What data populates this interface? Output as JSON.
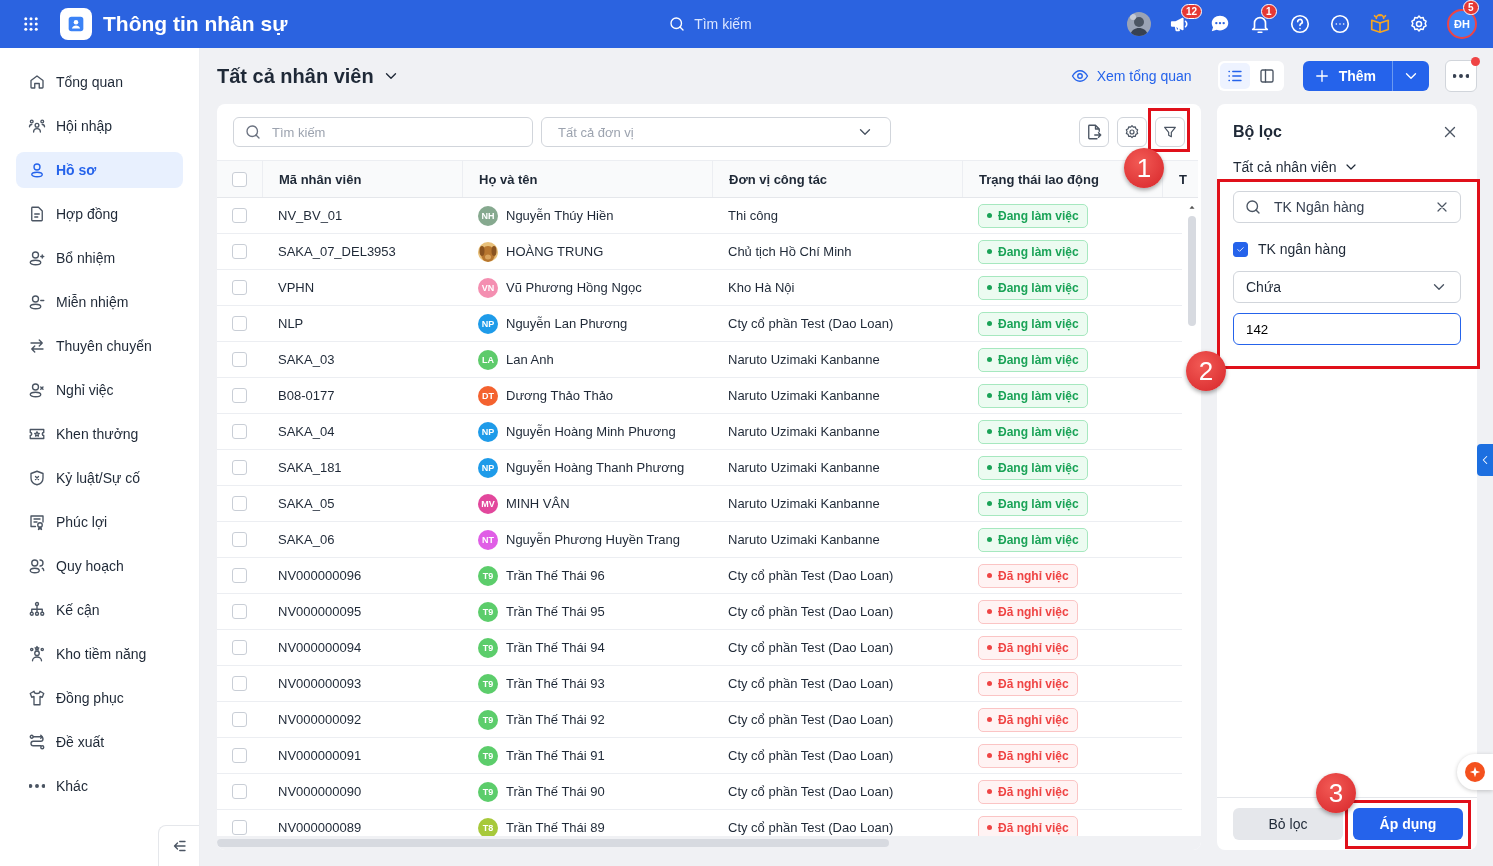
{
  "topbar": {
    "title": "Thông tin nhân sự",
    "search": {
      "placeholder": "Tìm kiếm"
    },
    "announcements_badge": "12",
    "notifications_badge": "1",
    "profile": {
      "initials": "ĐH",
      "badge": "5"
    }
  },
  "sidebar": {
    "items": [
      {
        "label": "Tổng quan",
        "selected": false
      },
      {
        "label": "Hội nhập",
        "selected": false
      },
      {
        "label": "Hồ sơ",
        "selected": true
      },
      {
        "label": "Hợp đồng",
        "selected": false
      },
      {
        "label": "Bổ nhiệm",
        "selected": false
      },
      {
        "label": "Miễn nhiệm",
        "selected": false
      },
      {
        "label": "Thuyên chuyển",
        "selected": false
      },
      {
        "label": "Nghỉ việc",
        "selected": false
      },
      {
        "label": "Khen thưởng",
        "selected": false
      },
      {
        "label": "Kỷ luật/Sự cố",
        "selected": false
      },
      {
        "label": "Phúc lợi",
        "selected": false
      },
      {
        "label": "Quy hoạch",
        "selected": false
      },
      {
        "label": "Kế cận",
        "selected": false
      },
      {
        "label": "Kho tiềm năng",
        "selected": false
      },
      {
        "label": "Đồng phục",
        "selected": false
      },
      {
        "label": "Đề xuất",
        "selected": false
      },
      {
        "label": "Khác",
        "selected": false
      }
    ]
  },
  "page": {
    "title": "Tất cả nhân viên",
    "overview_link": "Xem tổng quan",
    "views": [
      {
        "kind": "list",
        "selected": true
      },
      {
        "kind": "panel",
        "selected": false
      }
    ],
    "add_button": "Thêm"
  },
  "table": {
    "search": {
      "placeholder": "Tìm kiếm"
    },
    "unit_select": {
      "placeholder": "Tất cả đơn vị"
    },
    "all_checked": false,
    "columns": [
      "Mã nhân viên",
      "Họ và tên",
      "Đơn vị công tác",
      "Trạng thái lao động",
      "T"
    ],
    "rows": [
      {
        "checked": false,
        "code": "NV_BV_01",
        "avatar": {
          "kind": "initials",
          "text": "NH",
          "color": "#86a98f"
        },
        "name": "Nguyễn Thúy Hiền",
        "unit": "Thi công",
        "status": {
          "kind": "working",
          "label": "Đang làm việc"
        }
      },
      {
        "checked": false,
        "code": "SAKA_07_DEL3953",
        "name": "HOÀNG TRUNG",
        "unit": "Chủ tịch Hồ Chí Minh",
        "status": {
          "kind": "working",
          "label": "Đang làm việc"
        }
      },
      {
        "checked": false,
        "code": "VPHN",
        "avatar": {
          "kind": "initials",
          "text": "VN",
          "color": "#f48fb1"
        },
        "name": "Vũ Phương Hồng Ngọc",
        "unit": "Kho Hà Nội",
        "status": {
          "kind": "working",
          "label": "Đang làm việc"
        }
      },
      {
        "checked": false,
        "code": "NLP",
        "avatar": {
          "kind": "initials",
          "text": "NP",
          "color": "#1e9be9"
        },
        "name": "Nguyễn Lan Phương",
        "unit": "Cty cổ phần Test (Dao Loan)",
        "status": {
          "kind": "working",
          "label": "Đang làm việc"
        }
      },
      {
        "checked": false,
        "code": "SAKA_03",
        "avatar": {
          "kind": "initials",
          "text": "LA",
          "color": "#5ecb6b"
        },
        "name": "Lan Anh",
        "unit": "Naruto Uzimaki Kanbanne",
        "status": {
          "kind": "working",
          "label": "Đang làm việc"
        }
      },
      {
        "checked": false,
        "code": "B08-0177",
        "avatar": {
          "kind": "initials",
          "text": "DT",
          "color": "#f4622f"
        },
        "name": "Dương Thảo Thảo",
        "unit": "Naruto Uzimaki Kanbanne",
        "status": {
          "kind": "working",
          "label": "Đang làm việc"
        }
      },
      {
        "checked": false,
        "code": "SAKA_04",
        "avatar": {
          "kind": "initials",
          "text": "NP",
          "color": "#1e9be9"
        },
        "name": "Nguyễn Hoàng Minh Phương",
        "unit": "Naruto Uzimaki Kanbanne",
        "status": {
          "kind": "working",
          "label": "Đang làm việc"
        }
      },
      {
        "checked": false,
        "code": "SAKA_181",
        "avatar": {
          "kind": "initials",
          "text": "NP",
          "color": "#1e9be9"
        },
        "name": "Nguyễn Hoàng Thanh Phương",
        "unit": "Naruto Uzimaki Kanbanne",
        "status": {
          "kind": "working",
          "label": "Đang làm việc"
        }
      },
      {
        "checked": false,
        "code": "SAKA_05",
        "avatar": {
          "kind": "initials",
          "text": "MV",
          "color": "#e2479c"
        },
        "name": "MINH VÂN",
        "unit": "Naruto Uzimaki Kanbanne",
        "status": {
          "kind": "working",
          "label": "Đang làm việc"
        }
      },
      {
        "checked": false,
        "code": "SAKA_06",
        "avatar": {
          "kind": "initials",
          "text": "NT",
          "color": "#e05ee6"
        },
        "name": "Nguyễn Phương Huyền Trang",
        "unit": "Naruto Uzimaki Kanbanne",
        "status": {
          "kind": "working",
          "label": "Đang làm việc"
        }
      },
      {
        "checked": false,
        "code": "NV000000096",
        "avatar": {
          "kind": "initials",
          "text": "T9",
          "color": "#5ccd6b"
        },
        "name": "Trần Thế Thái 96",
        "unit": "Cty cổ phần Test (Dao Loan)",
        "status": {
          "kind": "left",
          "label": "Đã nghỉ việc"
        }
      },
      {
        "checked": false,
        "code": "NV000000095",
        "avatar": {
          "kind": "initials",
          "text": "T9",
          "color": "#5ccd6b"
        },
        "name": "Trần Thế Thái 95",
        "unit": "Cty cổ phần Test (Dao Loan)",
        "status": {
          "kind": "left",
          "label": "Đã nghỉ việc"
        }
      },
      {
        "checked": false,
        "code": "NV000000094",
        "avatar": {
          "kind": "initials",
          "text": "T9",
          "color": "#5ccd6b"
        },
        "name": "Trần Thế Thái 94",
        "unit": "Cty cổ phần Test (Dao Loan)",
        "status": {
          "kind": "left",
          "label": "Đã nghỉ việc"
        }
      },
      {
        "checked": false,
        "code": "NV000000093",
        "avatar": {
          "kind": "initials",
          "text": "T9",
          "color": "#5ccd6b"
        },
        "name": "Trần Thế Thái 93",
        "unit": "Cty cổ phần Test (Dao Loan)",
        "status": {
          "kind": "left",
          "label": "Đã nghỉ việc"
        }
      },
      {
        "checked": false,
        "code": "NV000000092",
        "avatar": {
          "kind": "initials",
          "text": "T9",
          "color": "#5ccd6b"
        },
        "name": "Trần Thế Thái 92",
        "unit": "Cty cổ phần Test (Dao Loan)",
        "status": {
          "kind": "left",
          "label": "Đã nghỉ việc"
        }
      },
      {
        "checked": false,
        "code": "NV000000091",
        "avatar": {
          "kind": "initials",
          "text": "T9",
          "color": "#5ccd6b"
        },
        "name": "Trần Thế Thái 91",
        "unit": "Cty cổ phần Test (Dao Loan)",
        "status": {
          "kind": "left",
          "label": "Đã nghỉ việc"
        }
      },
      {
        "checked": false,
        "code": "NV000000090",
        "avatar": {
          "kind": "initials",
          "text": "T9",
          "color": "#5ccd6b"
        },
        "name": "Trần Thế Thái 90",
        "unit": "Cty cổ phần Test (Dao Loan)",
        "status": {
          "kind": "left",
          "label": "Đã nghỉ việc"
        }
      },
      {
        "checked": false,
        "code": "NV000000089",
        "avatar": {
          "kind": "initials",
          "text": "T8",
          "color": "#a7c93b"
        },
        "name": "Trần Thế Thái 89",
        "unit": "Cty cổ phần Test (Dao Loan)",
        "status": {
          "kind": "left",
          "label": "Đã nghỉ việc"
        }
      }
    ]
  },
  "filter_panel": {
    "title": "Bộ lọc",
    "scope": "Tất cả nhân viên",
    "search": {
      "value": "TK Ngân hàng"
    },
    "field": {
      "label": "TK ngân hàng",
      "checked": true
    },
    "operator": "Chứa",
    "value": "142",
    "clear_button": "Bỏ lọc",
    "apply_button": "Áp dụng"
  },
  "annotations": [
    {
      "number": "1"
    },
    {
      "number": "2"
    },
    {
      "number": "3"
    }
  ]
}
